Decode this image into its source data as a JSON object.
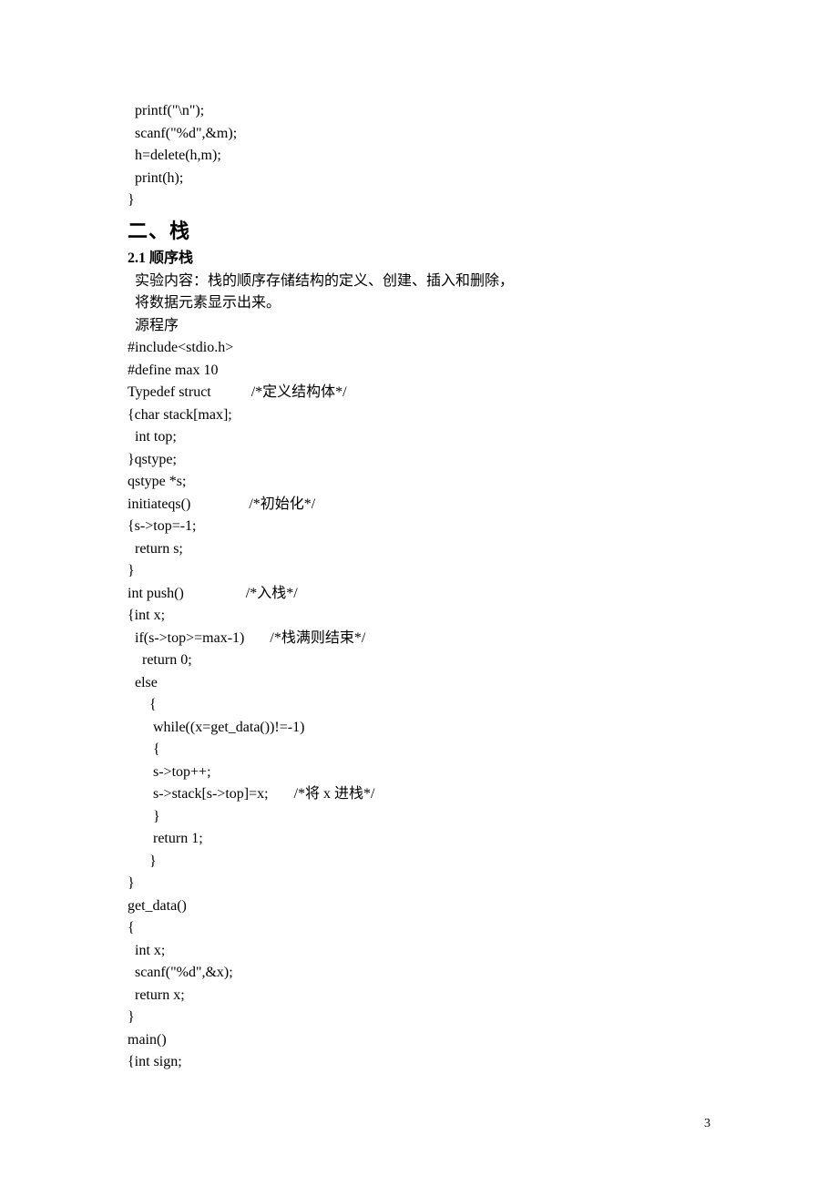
{
  "frag0": {
    "l0": "  printf(\"\\n\");",
    "l1": "  scanf(\"%d\",&m);",
    "l2": "  h=delete(h,m);",
    "l3": "  print(h);",
    "l4": "}"
  },
  "heading_stack": "二、栈",
  "heading_seq": "2.1 顺序栈",
  "desc": {
    "l0": "  实验内容：栈的顺序存储结构的定义、创建、插入和删除，",
    "l1": "  将数据元素显示出来。",
    "l2": "  源程序"
  },
  "code": {
    "l0": "#include<stdio.h>",
    "l1": "#define max 10",
    "l2": "Typedef struct           /*定义结构体*/",
    "l3": "{char stack[max];",
    "l4": "  int top;",
    "l5": "}qstype;",
    "l6": "qstype *s;",
    "l7": "initiateqs()                /*初始化*/",
    "l8": "{s->top=-1;",
    "l9": "  return s;",
    "l10": "}",
    "l11": "int push()                 /*入栈*/",
    "l12": "{int x;",
    "l13": "  if(s->top>=max-1)       /*栈满则结束*/",
    "l14": "    return 0;",
    "l15": "  else",
    "l16": "      {",
    "l17": "       while((x=get_data())!=-1)",
    "l18": "       {",
    "l19": "       s->top++;",
    "l20": "       s->stack[s->top]=x;       /*将 x 进栈*/",
    "l21": "       }",
    "l22": "       return 1;",
    "l23": "      }",
    "l24": "}",
    "l25": "get_data()",
    "l26": "{",
    "l27": "  int x;",
    "l28": "  scanf(\"%d\",&x);",
    "l29": "  return x;",
    "l30": "}",
    "l31": "main()",
    "l32": "{int sign;"
  },
  "page_number": "3"
}
